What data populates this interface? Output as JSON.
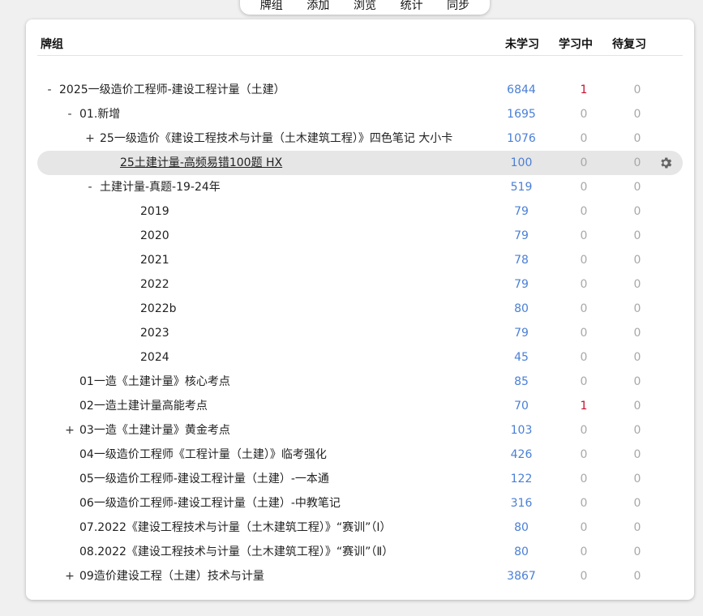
{
  "toolbar": {
    "decks": "牌组",
    "add": "添加",
    "browse": "浏览",
    "stats": "统计",
    "sync": "同步"
  },
  "header": {
    "deck": "牌组",
    "new": "未学习",
    "learning": "学习中",
    "review": "待复习"
  },
  "colors": {
    "new": "#4a7fd6",
    "learning": "#c8102e",
    "zero": "#a8a8a8"
  },
  "rows": [
    {
      "collapse": "-",
      "name": "2025一级造价工程师-建设工程计量（土建）",
      "new": "6844",
      "learning": "1",
      "review": "0"
    },
    {
      "collapse": "-",
      "name": "01.新增",
      "new": "1695",
      "learning": "0",
      "review": "0"
    },
    {
      "collapse": "+",
      "name": "25一级造价《建设工程技术与计量（土木建筑工程）》四色笔记 大小卡",
      "new": "1076",
      "learning": "0",
      "review": "0"
    },
    {
      "collapse": "",
      "name": "25土建计量-高频易错100题 HX",
      "new": "100",
      "learning": "0",
      "review": "0",
      "current": true
    },
    {
      "collapse": "-",
      "name": "土建计量-真题-19-24年",
      "new": "519",
      "learning": "0",
      "review": "0"
    },
    {
      "collapse": "",
      "name": "2019",
      "new": "79",
      "learning": "0",
      "review": "0"
    },
    {
      "collapse": "",
      "name": "2020",
      "new": "79",
      "learning": "0",
      "review": "0"
    },
    {
      "collapse": "",
      "name": "2021",
      "new": "78",
      "learning": "0",
      "review": "0"
    },
    {
      "collapse": "",
      "name": "2022",
      "new": "79",
      "learning": "0",
      "review": "0"
    },
    {
      "collapse": "",
      "name": "2022b",
      "new": "80",
      "learning": "0",
      "review": "0"
    },
    {
      "collapse": "",
      "name": "2023",
      "new": "79",
      "learning": "0",
      "review": "0"
    },
    {
      "collapse": "",
      "name": "2024",
      "new": "45",
      "learning": "0",
      "review": "0"
    },
    {
      "collapse": "",
      "name": "01一造《土建计量》核心考点",
      "new": "85",
      "learning": "0",
      "review": "0"
    },
    {
      "collapse": "",
      "name": "02一造土建计量高能考点",
      "new": "70",
      "learning": "1",
      "review": "0"
    },
    {
      "collapse": "+",
      "name": "03一造《土建计量》黄金考点",
      "new": "103",
      "learning": "0",
      "review": "0"
    },
    {
      "collapse": "",
      "name": "04一级造价工程师《工程计量（土建）》临考强化",
      "new": "426",
      "learning": "0",
      "review": "0"
    },
    {
      "collapse": "",
      "name": "05一级造价工程师-建设工程计量（土建）-一本通",
      "new": "122",
      "learning": "0",
      "review": "0"
    },
    {
      "collapse": "",
      "name": "06一级造价工程师-建设工程计量（土建）-中教笔记",
      "new": "316",
      "learning": "0",
      "review": "0"
    },
    {
      "collapse": "",
      "name": "07.2022《建设工程技术与计量（土木建筑工程）》“赛训”（Ⅰ）",
      "new": "80",
      "learning": "0",
      "review": "0"
    },
    {
      "collapse": "",
      "name": "08.2022《建设工程技术与计量（土木建筑工程）》“赛训”（Ⅱ）",
      "new": "80",
      "learning": "0",
      "review": "0"
    },
    {
      "collapse": "+",
      "name": "09造价建设工程（土建）技术与计量",
      "new": "3867",
      "learning": "0",
      "review": "0"
    }
  ]
}
